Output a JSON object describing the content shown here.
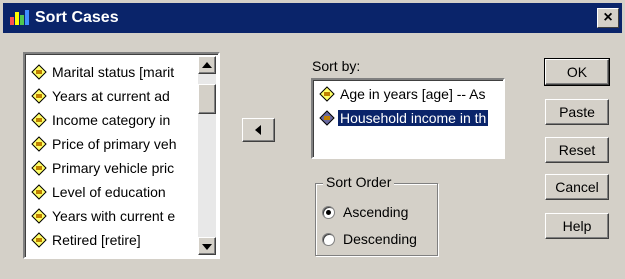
{
  "window": {
    "title": "Sort Cases",
    "close_glyph": "×"
  },
  "variable_list": {
    "items": [
      {
        "label": "Marital status [marit",
        "icon": "scale-variable-icon"
      },
      {
        "label": "Years at current ad",
        "icon": "scale-variable-icon"
      },
      {
        "label": "Income category in",
        "icon": "scale-variable-icon"
      },
      {
        "label": "Price of primary veh",
        "icon": "scale-variable-icon"
      },
      {
        "label": "Primary vehicle pric",
        "icon": "scale-variable-icon"
      },
      {
        "label": "Level of education",
        "icon": "scale-variable-icon"
      },
      {
        "label": "Years with current e",
        "icon": "scale-variable-icon"
      },
      {
        "label": "Retired [retire]",
        "icon": "scale-variable-icon"
      }
    ]
  },
  "move_button": {
    "icon": "arrow-left-icon"
  },
  "sort_by": {
    "label": "Sort by:",
    "items": [
      {
        "label": "Age in years [age] -- As",
        "icon": "scale-variable-icon",
        "selected": false
      },
      {
        "label": "Household income in th",
        "icon": "scale-variable-icon",
        "selected": true
      }
    ]
  },
  "sort_order": {
    "label": "Sort Order",
    "options": [
      {
        "label": "Ascending",
        "checked": true
      },
      {
        "label": "Descending",
        "checked": false
      }
    ]
  },
  "buttons": {
    "ok": "OK",
    "paste": "Paste",
    "reset": "Reset",
    "cancel": "Cancel",
    "help": "Help"
  },
  "colors": {
    "titlebar": "#0a246a",
    "face": "#d4d0c8",
    "selection": "#0a246a",
    "icon_yellow": "#ffff66"
  }
}
